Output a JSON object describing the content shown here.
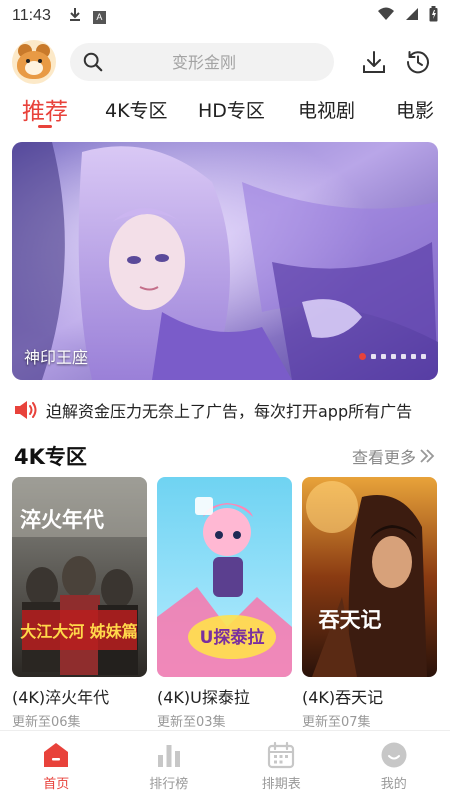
{
  "status_bar": {
    "time": "11:43"
  },
  "search": {
    "placeholder": "变形金刚"
  },
  "tabs": [
    {
      "label": "推荐",
      "active": true
    },
    {
      "label": "4K专区"
    },
    {
      "label": "HD专区"
    },
    {
      "label": "电视剧"
    },
    {
      "label": "电影"
    }
  ],
  "banner": {
    "caption": "神印王座",
    "dot_count": 7,
    "active_dot": 1
  },
  "notice": {
    "text": "迫解资金压力无奈上了广告，每次打开app所有广告"
  },
  "section": {
    "title": "4K专区",
    "more_label": "查看更多"
  },
  "cards": [
    {
      "title": "(4K)淬火年代",
      "subtitle": "更新至06集",
      "poster_text": "淬火年代",
      "poster_text2": "大江大河 姊妹篇"
    },
    {
      "title": "(4K)U探泰拉",
      "subtitle": "更新至03集",
      "poster_text": "U探泰拉"
    },
    {
      "title": "(4K)吞天记",
      "subtitle": "更新至07集",
      "poster_text": "吞天记"
    }
  ],
  "bottom_nav": [
    {
      "label": "首页",
      "icon": "home-icon",
      "active": true
    },
    {
      "label": "排行榜",
      "icon": "chart-icon"
    },
    {
      "label": "排期表",
      "icon": "calendar-icon"
    },
    {
      "label": "我的",
      "icon": "profile-icon"
    }
  ],
  "colors": {
    "accent": "#e8423b",
    "muted": "#999999",
    "search_bg": "#f2f2f2"
  }
}
